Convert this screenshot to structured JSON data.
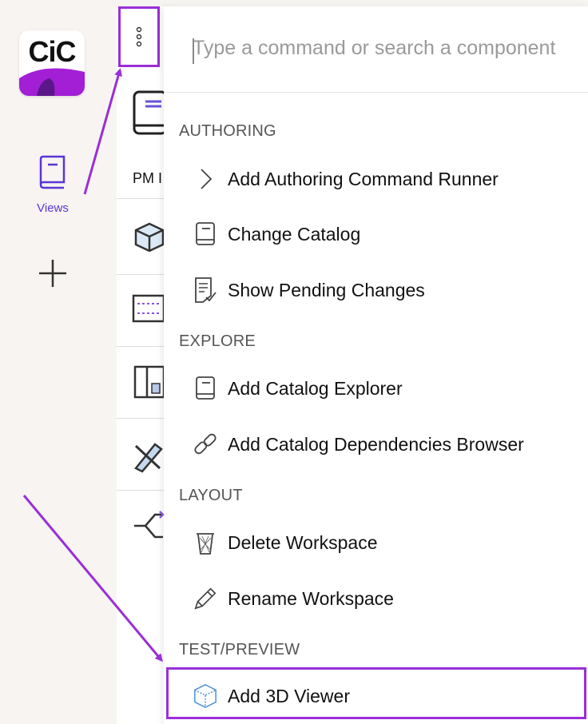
{
  "sidebar": {
    "logo_text": "CiC",
    "views_label": "Views"
  },
  "panel": {
    "pm_label": "PM I"
  },
  "command_palette": {
    "search_placeholder": "Type a command or search a component",
    "sections": [
      {
        "title": "AUTHORING",
        "items": [
          {
            "label": "Add Authoring Command Runner",
            "icon": "chevron-right-icon"
          },
          {
            "label": "Change Catalog",
            "icon": "book-icon"
          },
          {
            "label": "Show Pending Changes",
            "icon": "pending-changes-icon"
          }
        ]
      },
      {
        "title": "EXPLORE",
        "items": [
          {
            "label": "Add Catalog Explorer",
            "icon": "book-icon"
          },
          {
            "label": "Add Catalog Dependencies Browser",
            "icon": "link-icon"
          }
        ]
      },
      {
        "title": "LAYOUT",
        "items": [
          {
            "label": "Delete Workspace",
            "icon": "trash-icon"
          },
          {
            "label": "Rename Workspace",
            "icon": "pencil-icon"
          }
        ]
      },
      {
        "title": "TEST/PREVIEW",
        "items": [
          {
            "label": "Add 3D Viewer",
            "icon": "cube-icon"
          }
        ]
      }
    ]
  },
  "colors": {
    "accent": "#5a35d6",
    "annotation": "#9a2ed8",
    "logo_purple": "#a21fd6"
  }
}
